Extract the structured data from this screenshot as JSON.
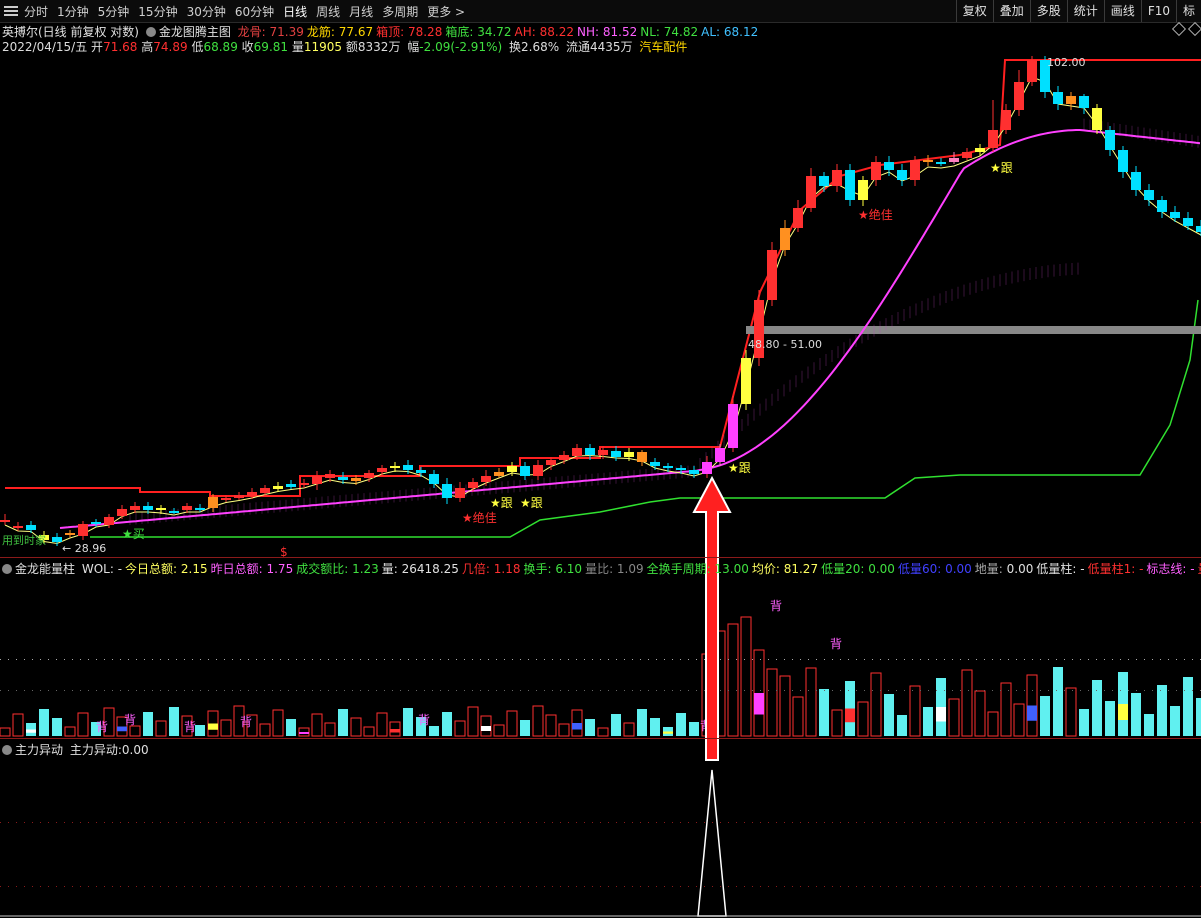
{
  "toolbar": {
    "tabs": [
      "分时",
      "1分钟",
      "5分钟",
      "15分钟",
      "30分钟",
      "60分钟",
      "日线",
      "周线",
      "月线",
      "多周期",
      "更多 >"
    ],
    "active": "日线",
    "right_buttons": [
      "复权",
      "叠加",
      "多股",
      "统计",
      "画线",
      "F10",
      "标"
    ]
  },
  "main": {
    "title": "英搏尔(日线 前复权 对数)",
    "indicator": "金龙图腾主图",
    "stats": [
      {
        "label": "龙骨:",
        "value": "71.39",
        "color": "#e04040"
      },
      {
        "label": "龙筋:",
        "value": "77.67",
        "color": "#ffd700"
      },
      {
        "label": "箱顶:",
        "value": "78.28",
        "color": "#ff3030"
      },
      {
        "label": "箱底:",
        "value": "34.72",
        "color": "#40e040"
      },
      {
        "label": "AH:",
        "value": "88.22",
        "color": "#ff3030"
      },
      {
        "label": "NH:",
        "value": "81.52",
        "color": "#ff60ff"
      },
      {
        "label": "NL:",
        "value": "74.82",
        "color": "#40e040"
      },
      {
        "label": "AL:",
        "value": "68.12",
        "color": "#40c0ff"
      }
    ],
    "quote": {
      "date": "2022/04/15/五",
      "open_label": "开",
      "open": "71.68",
      "high_label": "高",
      "high": "74.89",
      "low_label": "低",
      "low": "68.89",
      "close_label": "收",
      "close": "69.81",
      "vol_label": "量",
      "vol": "11905",
      "amt_label": "额",
      "amt": "8332万",
      "chg_label": "幅",
      "chg": "-2.09(-2.91%)",
      "turn_label": "换",
      "turn": "2.68%",
      "float_label": "流通",
      "float": "4435万",
      "sector": "汽车配件"
    },
    "price_high_label": "102.00",
    "price_low_label": "28.96",
    "box_label": "48.80 - 51.00",
    "left_text": "用到时家",
    "annotations": [
      {
        "text": "★绝佳",
        "color": "#ff3030"
      },
      {
        "text": "★跟",
        "color": "#ffff40"
      },
      {
        "text": "★跟",
        "color": "#ffff40"
      },
      {
        "text": "★跟",
        "color": "#ffff40"
      },
      {
        "text": "★绝佳",
        "color": "#ff3030"
      },
      {
        "text": "★跟",
        "color": "#ffff40"
      },
      {
        "text": "★买",
        "color": "#40e040"
      }
    ],
    "dollar": "$"
  },
  "vol_panel": {
    "name": "金龙能量柱",
    "items": [
      {
        "label": "WOL:",
        "value": "-",
        "color": "#e0e0e0"
      },
      {
        "label": "今日总额:",
        "value": "2.15",
        "color": "#ffff60"
      },
      {
        "label": "昨日总额:",
        "value": "1.75",
        "color": "#ff60ff"
      },
      {
        "label": "成交额比:",
        "value": "1.23",
        "color": "#40e040"
      },
      {
        "label": "量:",
        "value": "26418.25",
        "color": "#e0e0e0"
      },
      {
        "label": "几倍:",
        "value": "1.18",
        "color": "#ff3030"
      },
      {
        "label": "换手:",
        "value": "6.10",
        "color": "#40e040"
      },
      {
        "label": "量比:",
        "value": "1.09",
        "color": "#888888"
      },
      {
        "label": "全换手周期:",
        "value": "13.00",
        "color": "#40e040"
      },
      {
        "label": "均价:",
        "value": "81.27",
        "color": "#ffff60"
      },
      {
        "label": "低量20:",
        "value": "0.00",
        "color": "#40e040"
      },
      {
        "label": "低量60:",
        "value": "0.00",
        "color": "#4040ff"
      },
      {
        "label": "地量:",
        "value": "0.00",
        "color": "#aaaaaa"
      },
      {
        "label": "低量柱:",
        "value": "-",
        "color": "#e0e0e0"
      },
      {
        "label": "低量柱1:",
        "value": "-",
        "color": "#ff3030"
      },
      {
        "label": "标志线:",
        "value": "-",
        "color": "#ff60ff"
      },
      {
        "label": "量120:",
        "value": "",
        "color": "#ff3030"
      }
    ],
    "bei": "背"
  },
  "main_force": {
    "name": "主力异动",
    "label": "主力异动:",
    "value": "0.00"
  },
  "colors": {
    "up": "#ff3030",
    "down": "#00e0ff",
    "ma_pink": "#ff40ff",
    "ma_yellow": "#ffff80",
    "box_top": "#ff2020",
    "box_bottom": "#30e030",
    "box_gray": "#888888"
  }
}
